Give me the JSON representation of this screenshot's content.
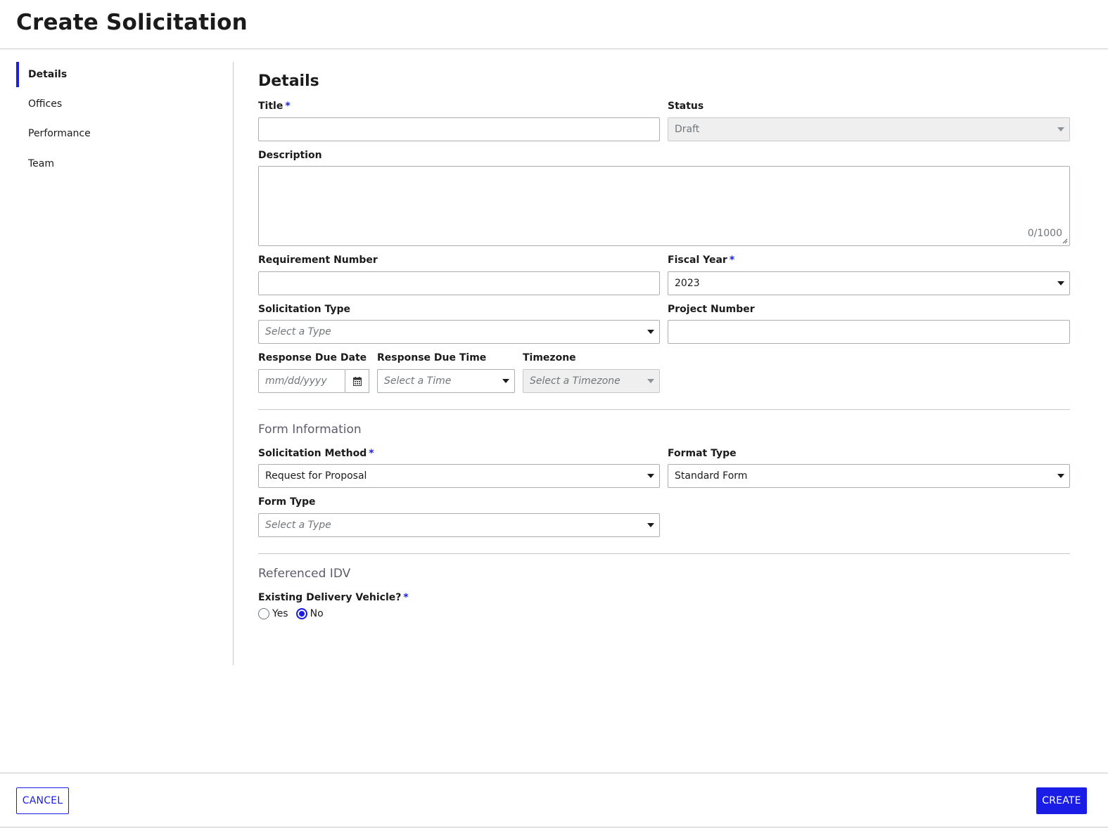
{
  "header": {
    "title": "Create Solicitation"
  },
  "sidebar": {
    "items": [
      {
        "label": "Details",
        "active": true
      },
      {
        "label": "Offices"
      },
      {
        "label": "Performance"
      },
      {
        "label": "Team"
      }
    ]
  },
  "details": {
    "heading": "Details",
    "title_label": "Title",
    "title_value": "",
    "required_mark": "*",
    "status_label": "Status",
    "status_value": "Draft",
    "description_label": "Description",
    "description_counter": "0/1000",
    "requirement_number_label": "Requirement Number",
    "fiscal_year_label": "Fiscal Year",
    "fiscal_year_value": "2023",
    "solicitation_type_label": "Solicitation Type",
    "solicitation_type_placeholder": "Select a Type",
    "project_number_label": "Project Number",
    "response_due_date_label": "Response Due Date",
    "response_due_date_placeholder": "mm/dd/yyyy",
    "response_due_time_label": "Response Due Time",
    "response_due_time_placeholder": "Select a Time",
    "timezone_label": "Timezone",
    "timezone_placeholder": "Select a Timezone"
  },
  "form_info": {
    "heading": "Form Information",
    "solicitation_method_label": "Solicitation Method",
    "solicitation_method_value": "Request for Proposal",
    "format_type_label": "Format Type",
    "format_type_value": "Standard Form",
    "form_type_label": "Form Type",
    "form_type_placeholder": "Select a Type"
  },
  "idv": {
    "heading": "Referenced IDV",
    "existing_vehicle_label": "Existing Delivery Vehicle?",
    "options": [
      {
        "label": "Yes",
        "checked": false
      },
      {
        "label": "No",
        "checked": true
      }
    ]
  },
  "footer": {
    "cancel_label": "CANCEL",
    "create_label": "CREATE"
  },
  "colors": {
    "accent": "#1a1de6",
    "border": "#a9aeb1",
    "divider": "#c9c9c9",
    "disabled_bg": "#efefef"
  }
}
